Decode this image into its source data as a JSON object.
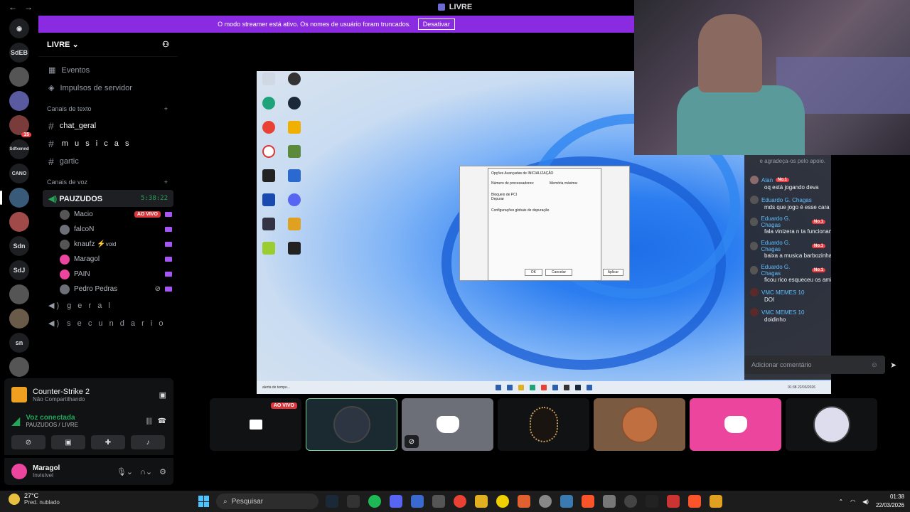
{
  "window": {
    "title": "LIVRE",
    "back": "←",
    "forward": "→"
  },
  "banner": {
    "text": "O modo streamer está ativo. Os nomes de usuário foram truncados.",
    "button": "Desativar"
  },
  "rail": {
    "servers": [
      "SdEB",
      "Sdfxennd",
      "CANO",
      "Sdn",
      "SdJ",
      "sn"
    ],
    "badge": "15"
  },
  "sidebar": {
    "server_name": "LIVRE",
    "events": "Eventos",
    "boosts": "Impulsos de servidor",
    "text_category": "Canais de texto",
    "text_channels": [
      "chat_geral",
      "m u s i c a s",
      "gartic"
    ],
    "voice_category": "Canais de voz",
    "voice_channel": {
      "name": "PAUZUDOS",
      "timer": "5:38:22"
    },
    "voice_users": [
      {
        "name": "Macio",
        "live": "AO VIVO"
      },
      {
        "name": "falcoN"
      },
      {
        "name": "knaufz",
        "tag": "void"
      },
      {
        "name": "Maragol"
      },
      {
        "name": "PAIN"
      },
      {
        "name": "Pedro Pedras"
      }
    ],
    "other_voice": [
      "g e r a l",
      "s e c u n d a r i o"
    ]
  },
  "activity": {
    "game": "Counter-Strike 2",
    "status": "Não Compartilhando"
  },
  "voice_panel": {
    "status": "Voz conectada",
    "channel": "PAUZUDOS / LIVRE"
  },
  "user_panel": {
    "name": "Maragol",
    "status": "Invisível"
  },
  "chat": {
    "top_text": "e agradeça-os pelo apoio.",
    "messages": [
      {
        "author": "Alan",
        "badge": "No.1",
        "text": "oq está jogando deva"
      },
      {
        "author": "Eduardo G. Chagas",
        "badge": "",
        "text": "mds que jogo é esse cara"
      },
      {
        "author": "Eduardo G. Chagas",
        "badge": "No.1",
        "text": "fala vinizera n ta funcionando esse mic ai?"
      },
      {
        "author": "Eduardo G. Chagas",
        "badge": "No.1",
        "text": "baixa a musica barbozinha"
      },
      {
        "author": "Eduardo G. Chagas",
        "badge": "No.1",
        "text": "ficou rico esqueceu os amigo pobre"
      },
      {
        "author": "VMC MEMES 10",
        "badge": "",
        "text": "DOI"
      },
      {
        "author": "VMC MEMES 10",
        "badge": "",
        "text": "doidinho"
      }
    ],
    "input_placeholder": "Adicionar comentário"
  },
  "stream": {
    "dialog_title": "Opções Avançadas de INICIALIZAÇÃO",
    "checkbox1": "Número de processadores:",
    "checkbox2": "Memória máxima:",
    "checkbox3": "Bloqueio de PCI",
    "checkbox4": "Depurar",
    "section": "Configurações globais de depuração",
    "ok": "OK",
    "cancel": "Cancelar",
    "apply": "Aplicar",
    "tray_time": "01:38",
    "tray_date": "22/03/2026",
    "weather": "alerta de tempe..."
  },
  "tiles": {
    "live": "AO VIVO"
  },
  "taskbar": {
    "temp": "27°C",
    "cond": "Pred. nublado",
    "search": "Pesquisar",
    "time": "01:38",
    "date": "22/03/2026"
  },
  "colors": {
    "accent": "#8a2be2",
    "live": "#da373c",
    "online": "#23a55a",
    "chat_author": "#5fbfff"
  }
}
